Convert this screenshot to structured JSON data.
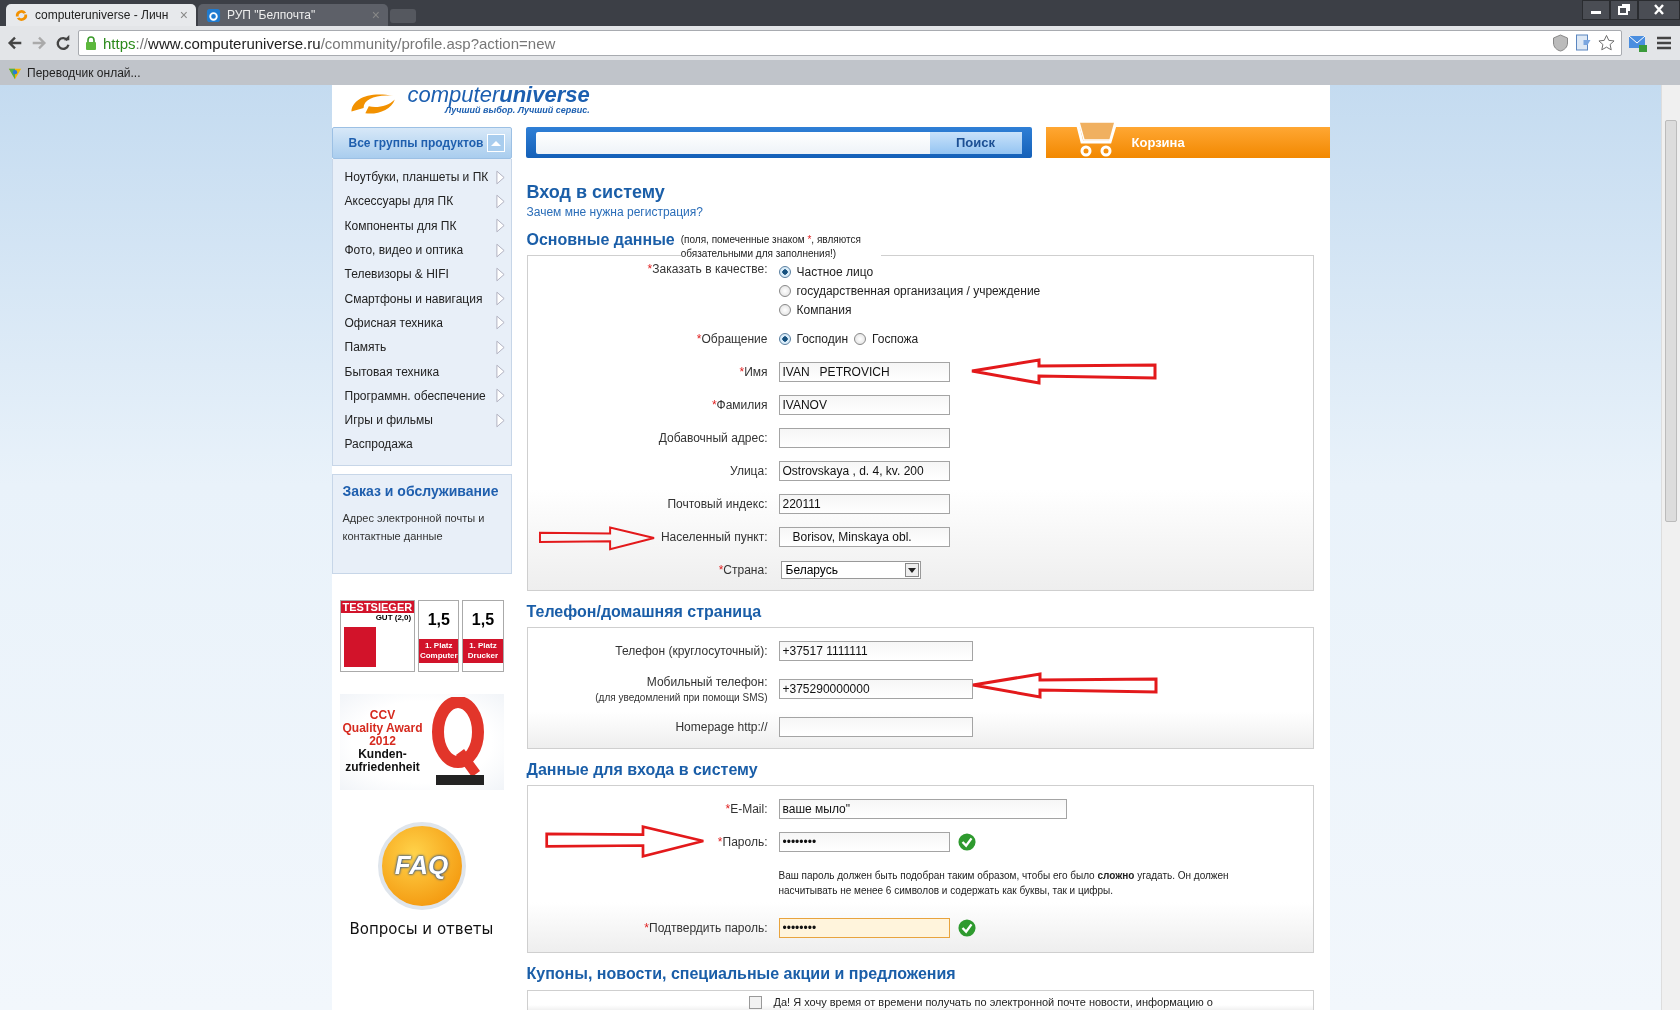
{
  "browser": {
    "tabs": [
      {
        "title": "computeruniverse - Личн",
        "kind": "swirl",
        "selected": true,
        "close": "×"
      },
      {
        "title": "РУП \"Белпочта\"",
        "kind": "app",
        "selected": false,
        "close": "×"
      }
    ],
    "url": {
      "scheme": "https",
      "separator": "://",
      "host": "www.computeruniverse.ru",
      "path": "/community/profile.asp?action=new"
    },
    "bookmarks": [
      "Переводчик онлай..."
    ]
  },
  "header": {
    "logo": {
      "light": "computer",
      "bold": "universe",
      "tagline": "Лучший выбор. Лучший сервис."
    },
    "search_button": "Поиск",
    "cart": "Корзина"
  },
  "sidebar": {
    "header": {
      "label": "Все группы продуктов",
      "expanded": true
    },
    "categories": [
      {
        "label": "Ноутбуки, планшеты и ПК",
        "has_submenu": true
      },
      {
        "label": "Аксессуары для ПК",
        "has_submenu": true
      },
      {
        "label": "Компоненты для ПК",
        "has_submenu": true
      },
      {
        "label": "Фото, видео и оптика",
        "has_submenu": true
      },
      {
        "label": "Телевизоры & HIFI",
        "has_submenu": true
      },
      {
        "label": "Смартфоны и навигация",
        "has_submenu": true
      },
      {
        "label": "Офисная техника",
        "has_submenu": true
      },
      {
        "label": "Память",
        "has_submenu": true
      },
      {
        "label": "Бытовая техника",
        "has_submenu": true
      },
      {
        "label": "Программн. обеспечение",
        "has_submenu": true
      },
      {
        "label": "Игры и фильмы",
        "has_submenu": true
      },
      {
        "label": "Распродажа",
        "has_submenu": false
      }
    ],
    "service": {
      "title": "Заказ и обслуживание",
      "link": "Адрес электронной почты и контактные данные"
    },
    "badges": [
      {
        "kind": "seal",
        "title": "TESTSIEGER",
        "grade": "GUT (2,0)"
      },
      {
        "kind": "score",
        "score": "1,5",
        "place": "1. Platz",
        "category": "Computer"
      },
      {
        "kind": "score",
        "score": "1,5",
        "place": "1. Platz",
        "category": "Drucker"
      }
    ],
    "award": {
      "red_lines": [
        "CCV",
        "Quality Award",
        "2012"
      ],
      "dark_lines": [
        "Kunden-",
        "zufriedenheit"
      ]
    },
    "faq": {
      "badge": "FAQ",
      "caption": "Вопросы и ответы"
    }
  },
  "form": {
    "title": "Вход в систему",
    "link": "Зачем мне нужна регистрация?",
    "sections": [
      {
        "title": "Основные данные",
        "note": {
          "before": "(поля, помеченные знаком ",
          "mark": "*",
          "after": ", являются обязательными для заполнения!)"
        },
        "fields": [
          {
            "kind": "radio_group",
            "label": "Заказать в качестве:",
            "required": true,
            "options": [
              {
                "label": "Частное лицо",
                "selected": true
              },
              {
                "label": "государственная организация / учреждение",
                "selected": false
              },
              {
                "label": "Компания",
                "selected": false
              }
            ]
          },
          {
            "kind": "radio_inline",
            "label": "Обращение",
            "required": true,
            "options": [
              {
                "label": "Господин",
                "selected": true
              },
              {
                "label": "Госпожа",
                "selected": false
              }
            ]
          },
          {
            "kind": "text",
            "label": "Имя",
            "required": true,
            "value": "IVAN   PETROVICH",
            "arrow_from_right": true
          },
          {
            "kind": "text",
            "label": "Фамилия",
            "required": true,
            "value": "IVANOV"
          },
          {
            "kind": "text",
            "label": "Добавочный адрес:",
            "required": false
          },
          {
            "kind": "text",
            "label": "Улица:",
            "required": false,
            "value": "Ostrovskaya , d. 4, kv. 200"
          },
          {
            "kind": "text",
            "label": "Почтовый индекс:",
            "required": false,
            "value": "220111"
          },
          {
            "kind": "text",
            "label": "Населенный пункт:",
            "required": false,
            "value": "   Borisov, Minskaya obl.",
            "arrow_from_left": true
          },
          {
            "kind": "select",
            "label": "Страна:",
            "required": true,
            "value": "Беларусь"
          }
        ]
      },
      {
        "title": "Телефон/домашняя страница",
        "fields": [
          {
            "kind": "text",
            "label": "Телефон (круглосуточный):",
            "required": false,
            "value": "+37517 1111111",
            "wide": true
          },
          {
            "kind": "text",
            "label": "Мобильный телефон:",
            "sublabel": "(для уведомлений при помощи SMS)",
            "required": false,
            "value": "+375290000000",
            "wide": true,
            "arrow_from_right": true
          },
          {
            "kind": "text",
            "label": "Homepage http://",
            "required": false,
            "wide": true
          }
        ]
      },
      {
        "title": "Данные для входа в систему",
        "fields": [
          {
            "kind": "email",
            "label": "E-Mail:",
            "required": true,
            "value": "ваше мыло\""
          },
          {
            "kind": "password",
            "label": "Пароль:",
            "required": true,
            "value": "••••••••",
            "valid": true,
            "focused": false,
            "arrow_from_left": true
          },
          {
            "kind": "hint",
            "text": "Ваш пароль должен быть подобран таким образом, чтобы его было **сложно** угадать. Он должен насчитывать не менее 6 символов и содержать как буквы, так и цифры."
          },
          {
            "kind": "password",
            "label": "Подтвердить пароль:",
            "required": true,
            "value": "••••••••",
            "valid": true,
            "focused": true
          }
        ]
      },
      {
        "title": "Купоны, новости, специальные акции и предложения",
        "fields": [
          {
            "kind": "checkbox",
            "label": "Да! Я хочу время от времени получать по электронной почте новости, информацию о",
            "checked": false
          }
        ]
      }
    ]
  }
}
